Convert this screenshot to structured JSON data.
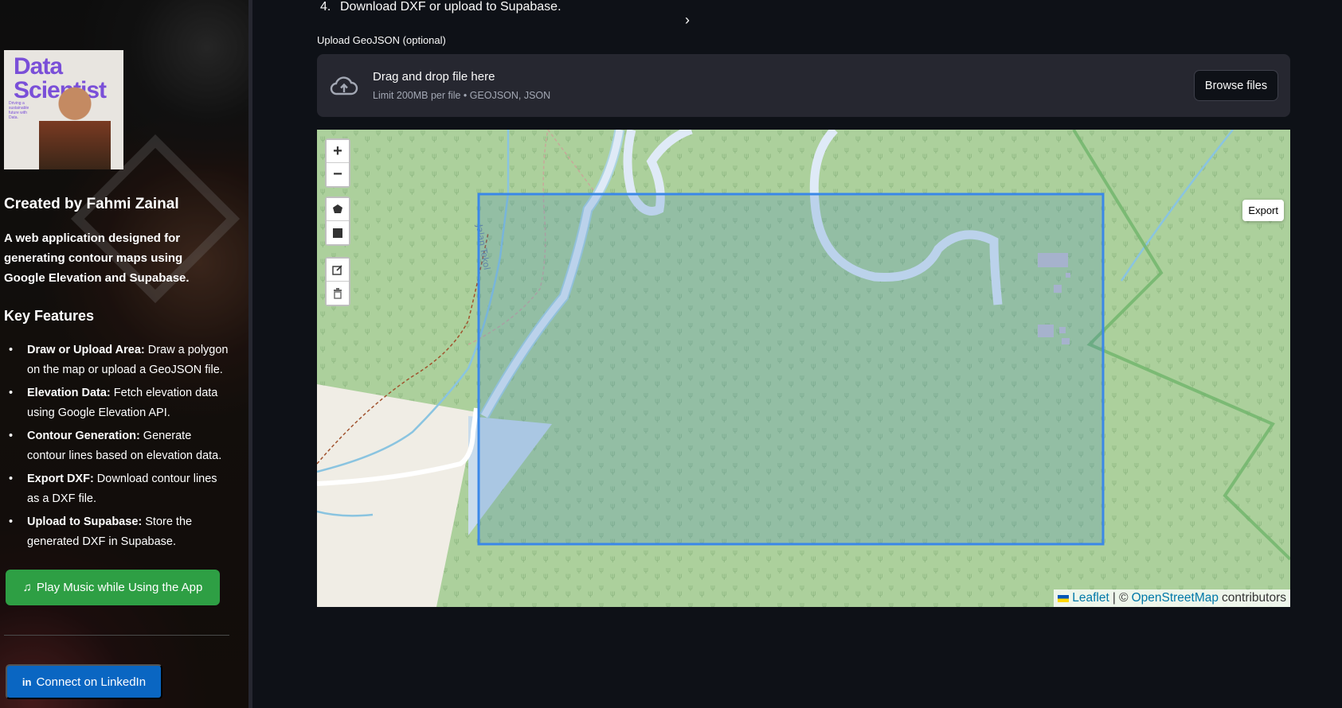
{
  "sidebar": {
    "profile_image_title": "Data Scientist",
    "profile_caption": "Driving a sustainable future with Data.",
    "creator": "Created by Fahmi Zainal",
    "description": "A web application designed for generating contour maps using Google Elevation and Supabase.",
    "features_heading": "Key Features",
    "features": [
      {
        "title": "Draw or Upload Area:",
        "text": " Draw a polygon on the map or upload a GeoJSON file."
      },
      {
        "title": "Elevation Data:",
        "text": " Fetch elevation data using Google Elevation API."
      },
      {
        "title": "Contour Generation:",
        "text": " Generate contour lines based on elevation data."
      },
      {
        "title": "Export DXF:",
        "text": " Download contour lines as a DXF file."
      },
      {
        "title": "Upload to Supabase:",
        "text": " Store the generated DXF in Supabase."
      }
    ],
    "music_button": "Play Music while Using the App",
    "music_icon": "music-note-icon",
    "linkedin_button": "Connect on LinkedIn",
    "linkedin_icon": "linkedin-icon",
    "colors": {
      "music_button": "#2e9f44",
      "linkedin_button": "#0a66c2"
    }
  },
  "main": {
    "step": {
      "number": "4.",
      "text": "Download DXF or upload to Supabase."
    },
    "upload": {
      "label": "Upload GeoJSON (optional)",
      "title": "Drag and drop file here",
      "subtitle": "Limit 200MB per file • GEOJSON, JSON",
      "browse_button": "Browse files",
      "icon": "cloud-upload-icon"
    },
    "map": {
      "zoom_in": "+",
      "zoom_out": "−",
      "export_button": "Export",
      "attribution": {
        "leaflet": "Leaflet",
        "separator": "| ©",
        "osm": "OpenStreetMap",
        "suffix": "contributors"
      },
      "draw_tools": [
        "draw-polygon-icon",
        "draw-rectangle-icon",
        "edit-layers-icon",
        "delete-layers-icon"
      ],
      "street_label": "Jalan Tekol"
    }
  }
}
